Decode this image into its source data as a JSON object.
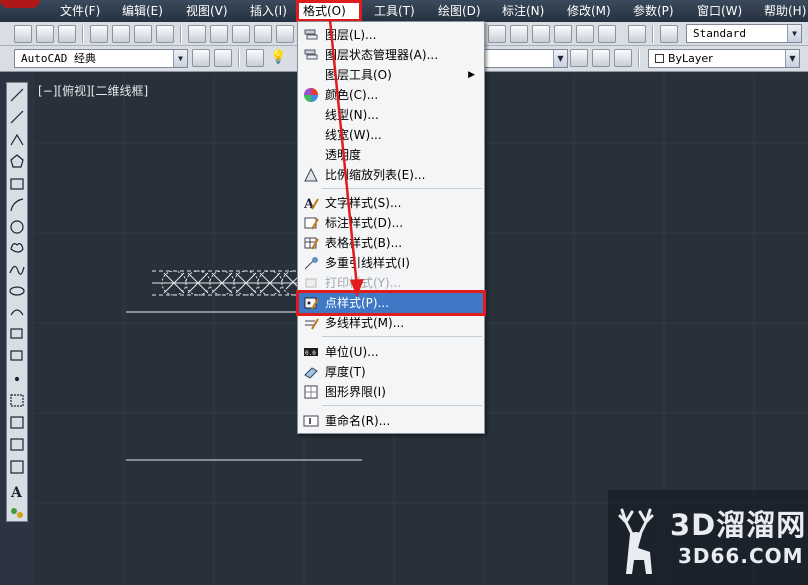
{
  "menubar": {
    "items": [
      {
        "label": "文件(F)"
      },
      {
        "label": "编辑(E)"
      },
      {
        "label": "视图(V)"
      },
      {
        "label": "插入(I)"
      },
      {
        "label": "格式(O)"
      },
      {
        "label": "工具(T)"
      },
      {
        "label": "绘图(D)"
      },
      {
        "label": "标注(N)"
      },
      {
        "label": "修改(M)"
      },
      {
        "label": "参数(P)"
      },
      {
        "label": "窗口(W)"
      },
      {
        "label": "帮助(H)"
      }
    ],
    "active_item": "格式(O)"
  },
  "toolbar": {
    "text_style_combo": "Standard",
    "workspace_combo": "AutoCAD 经典",
    "linetype_combo": "ByLayer"
  },
  "viewport": {
    "label": "[−][俯视][二维线框]"
  },
  "format_menu": {
    "items": [
      {
        "label": "图层(L)...",
        "icon": "layer-icon",
        "enabled": true
      },
      {
        "label": "图层状态管理器(A)...",
        "icon": "layer-state-icon",
        "enabled": true
      },
      {
        "label": "图层工具(O)",
        "icon": "",
        "enabled": true,
        "submenu": true
      },
      {
        "label": "颜色(C)...",
        "icon": "color-wheel-icon",
        "enabled": true
      },
      {
        "label": "线型(N)...",
        "icon": "",
        "enabled": true
      },
      {
        "label": "线宽(W)...",
        "icon": "",
        "enabled": true
      },
      {
        "label": "透明度",
        "icon": "",
        "enabled": true
      },
      {
        "label": "比例缩放列表(E)...",
        "icon": "scale-list-icon",
        "enabled": true
      },
      {
        "label": "文字样式(S)...",
        "icon": "text-style-icon",
        "enabled": true
      },
      {
        "label": "标注样式(D)...",
        "icon": "dimension-style-icon",
        "enabled": true
      },
      {
        "label": "表格样式(B)...",
        "icon": "table-style-icon",
        "enabled": true
      },
      {
        "label": "多重引线样式(I)",
        "icon": "multileader-style-icon",
        "enabled": true
      },
      {
        "label": "打印样式(Y)...",
        "icon": "plot-style-icon",
        "enabled": false
      },
      {
        "label": "点样式(P)...",
        "icon": "point-style-icon",
        "enabled": true,
        "highlighted": true
      },
      {
        "label": "多线样式(M)...",
        "icon": "multiline-style-icon",
        "enabled": true
      },
      {
        "label": "单位(U)...",
        "icon": "units-icon",
        "enabled": true
      },
      {
        "label": "厚度(T)",
        "icon": "thickness-icon",
        "enabled": true
      },
      {
        "label": "图形界限(I)",
        "icon": "limits-icon",
        "enabled": true
      },
      {
        "label": "重命名(R)...",
        "icon": "rename-icon",
        "enabled": true
      }
    ]
  },
  "watermark": {
    "brand": "3D溜溜网",
    "url": "3D66.COM"
  },
  "colors": {
    "highlight": "#3f79c6",
    "annotation_red": "#e01c1c",
    "canvas": "#283039"
  }
}
